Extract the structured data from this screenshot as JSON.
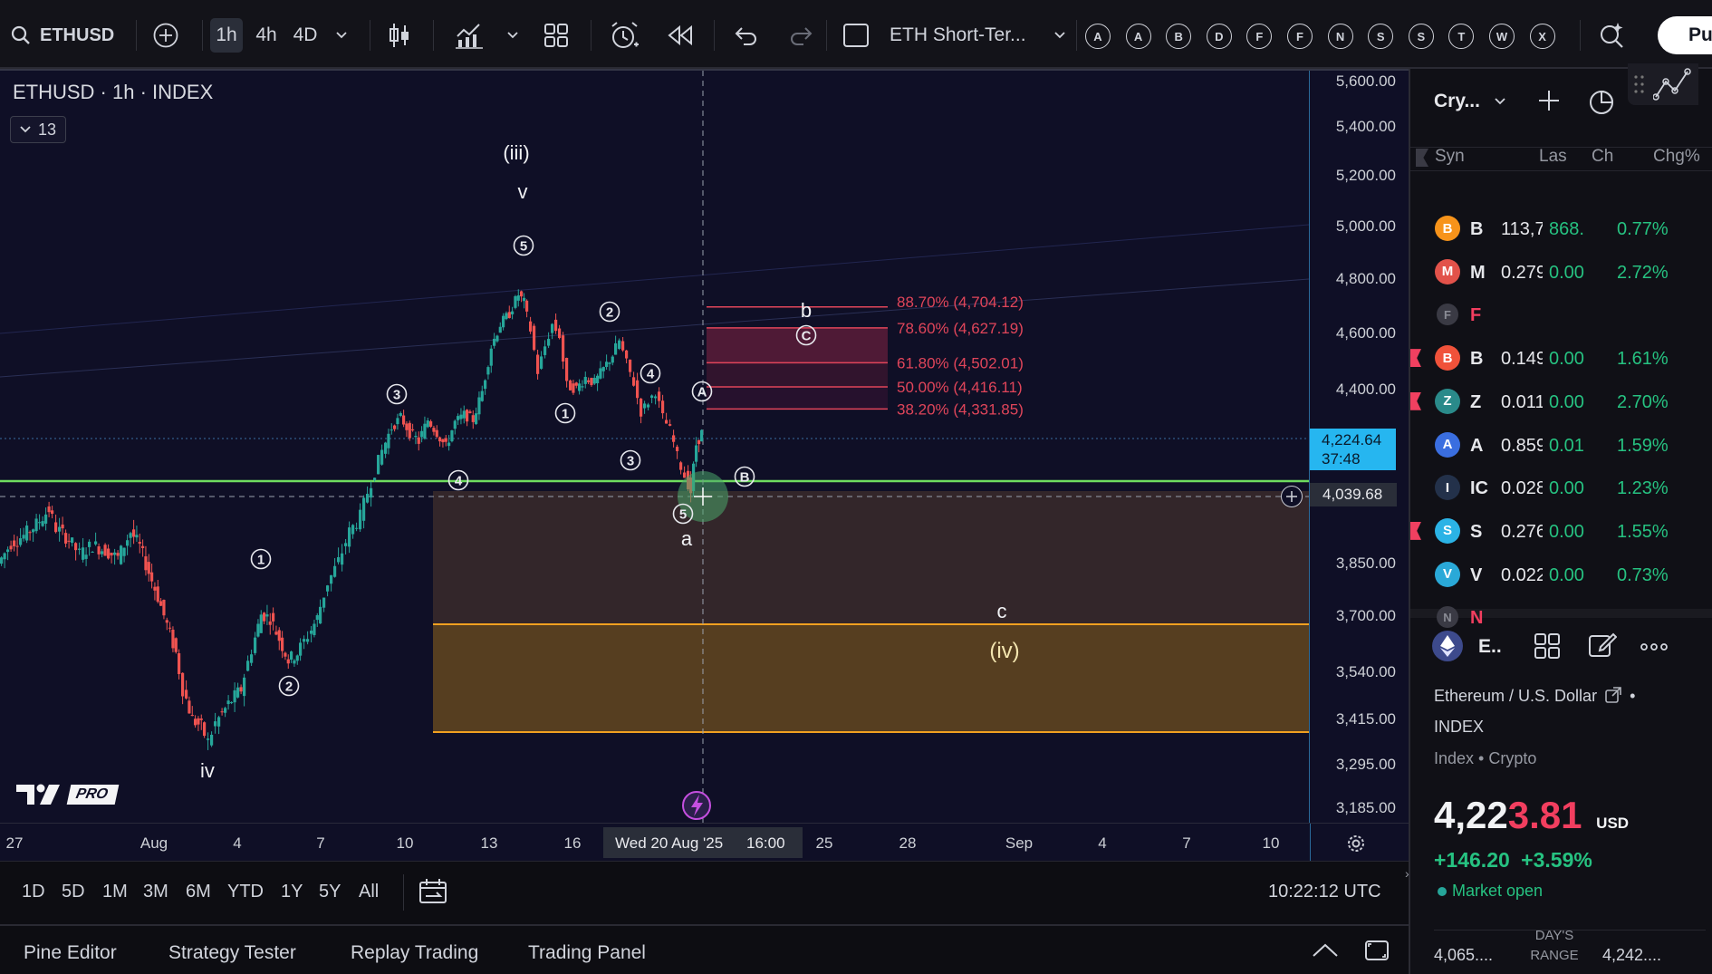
{
  "toolbar": {
    "symbol": "ETHUSD",
    "intervals": [
      "1h",
      "4h",
      "4D"
    ],
    "layout_name": "ETH Short-Ter...",
    "alert_letters": [
      "A",
      "A",
      "B",
      "D",
      "F",
      "F",
      "N",
      "S",
      "S",
      "T",
      "W",
      "X"
    ],
    "publish_label": "Pub"
  },
  "chart": {
    "legend_title": "ETHUSD · 1h · INDEX",
    "indicator_count": "13",
    "logo_badge": "PRO",
    "price_labels": [
      "5,600.00",
      "5,400.00",
      "5,200.00",
      "5,000.00",
      "4,800.00",
      "4,600.00",
      "4,400.00",
      "3,850.00",
      "3,700.00",
      "3,540.00",
      "3,415.00",
      "3,295.00",
      "3,185.00"
    ],
    "current_price": "4,224.64",
    "countdown": "37:48",
    "crosshair_price": "4,039.68",
    "time_labels": [
      "27",
      "Aug",
      "4",
      "7",
      "10",
      "13",
      "16",
      "25",
      "28",
      "Sep",
      "4",
      "7",
      "10"
    ],
    "crosshair_time": "Wed 20 Aug '25",
    "crosshair_hour": "16:00",
    "fib_levels": [
      "88.70% (4,704.12)",
      "78.60% (4,627.19)",
      "61.80% (4,502.01)",
      "50.00% (4,416.11)",
      "38.20% (4,331.85)"
    ],
    "wave_labels": {
      "iii": "(iii)",
      "v": "v",
      "iv_low": "iv",
      "b": "b",
      "a": "a",
      "c": "c",
      "iv_target": "(iv)",
      "c1": "1",
      "c2": "2",
      "c3": "3",
      "c4": "4",
      "c5": "5",
      "cA": "A",
      "cB": "B",
      "cC": "C"
    },
    "colors": {
      "bull": "#26a69a",
      "bear": "#ef5350",
      "green_line": "#6fdc5f",
      "fib_red": "#e0455a",
      "target_orange": "#f0a020",
      "current_price_bg": "#29b6f6"
    }
  },
  "range_bar": {
    "ranges": [
      "1D",
      "5D",
      "1M",
      "3M",
      "6M",
      "YTD",
      "1Y",
      "5Y",
      "All"
    ],
    "clock": "10:22:12 UTC"
  },
  "bottom_tabs": [
    "Pine Editor",
    "Strategy Tester",
    "Replay Trading",
    "Trading Panel"
  ],
  "watchlist": {
    "title": "Cry...",
    "columns": [
      "Syn",
      "Las",
      "Ch",
      "Chg%"
    ],
    "rows": [
      {
        "sym": "B",
        "last": "113,7",
        "ch": "868.",
        "chg": "0.77%",
        "color": "#f7931a",
        "flag": false
      },
      {
        "sym": "M",
        "last": "0.279",
        "ch": "0.00",
        "chg": "2.72%",
        "color": "#e2524a",
        "flag": false
      },
      {
        "sym": "F",
        "last": "",
        "ch": "",
        "chg": "",
        "color": "#3a3a44",
        "flag": false
      },
      {
        "sym": "B",
        "last": "0.149",
        "ch": "0.00",
        "chg": "1.61%",
        "color": "#f0523a",
        "flag": true
      },
      {
        "sym": "Z",
        "last": "0.011",
        "ch": "0.00",
        "chg": "2.70%",
        "color": "#2a8a8a",
        "flag": true
      },
      {
        "sym": "A",
        "last": "0.859",
        "ch": "0.01",
        "chg": "1.59%",
        "color": "#3a6ee0",
        "flag": false
      },
      {
        "sym": "IC",
        "last": "0.028",
        "ch": "0.00",
        "chg": "1.23%",
        "color": "#23314a",
        "flag": false
      },
      {
        "sym": "S",
        "last": "0.276",
        "ch": "0.00",
        "chg": "1.55%",
        "color": "#2bb3e6",
        "flag": true
      },
      {
        "sym": "V",
        "last": "0.022",
        "ch": "0.00",
        "chg": "0.73%",
        "color": "#2aa9d8",
        "flag": false
      },
      {
        "sym": "N",
        "last": "",
        "ch": "",
        "chg": "",
        "color": "#3a3a44",
        "flag": false
      }
    ]
  },
  "details": {
    "short_name": "E..",
    "full_name": "Ethereum / U.S. Dollar",
    "exchange": "INDEX",
    "type": "Index • Crypto",
    "price_main": "4,22",
    "price_tail": "3.81",
    "currency": "USD",
    "change": "+146.20",
    "change_pct": "+3.59%",
    "market_status": "Market open",
    "day_low": "4,065....",
    "day_range_label": "DAY'S RANGE",
    "day_high": "4,242...."
  }
}
